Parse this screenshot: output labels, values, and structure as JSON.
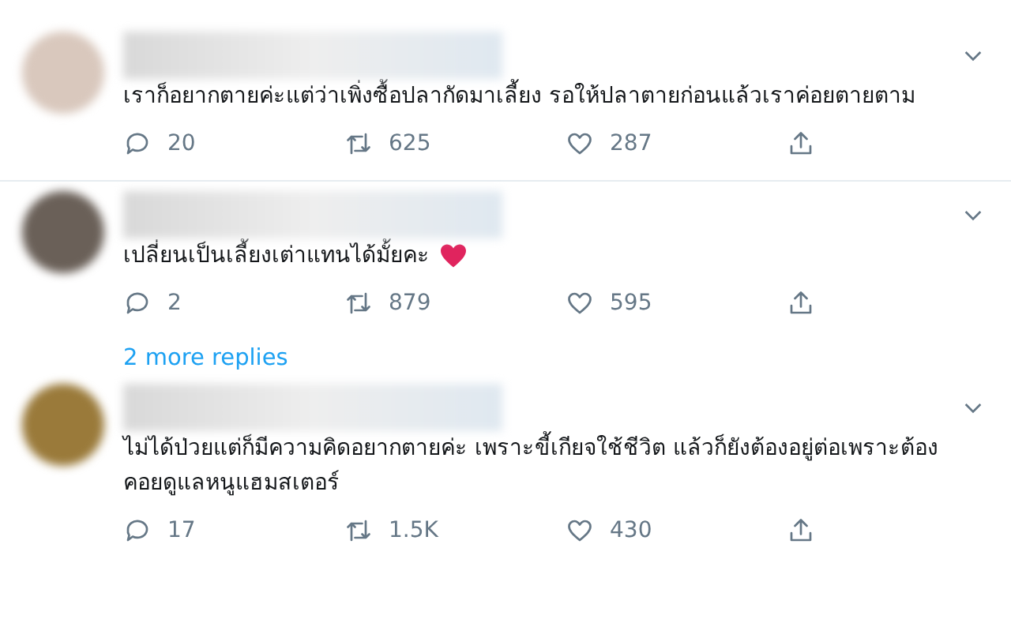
{
  "tweets": [
    {
      "text": "เราก็อยากตายค่ะแต่ว่าเพิ่งซื้อปลากัดมาเลี้ยง รอให้ปลาตายก่อนแล้วเราค่อยตายตาม",
      "heart": false,
      "replies": "20",
      "retweets": "625",
      "likes": "287"
    },
    {
      "text": "เปลี่ยนเป็นเลี้ยงเต่าแทนได้มั้ยคะ",
      "heart": true,
      "replies": "2",
      "retweets": "879",
      "likes": "595",
      "more_replies": "2 more replies"
    },
    {
      "text": "ไม่ได้ป่วยแต่ก็มีความคิดอยากตายค่ะ เพราะขี้เกียจใช้ชีวิต แล้วก็ยังต้องอยู่ต่อเพราะต้องคอยดูแลหนูแฮมสเตอร์",
      "heart": false,
      "replies": "17",
      "retweets": "1.5K",
      "likes": "430"
    }
  ]
}
